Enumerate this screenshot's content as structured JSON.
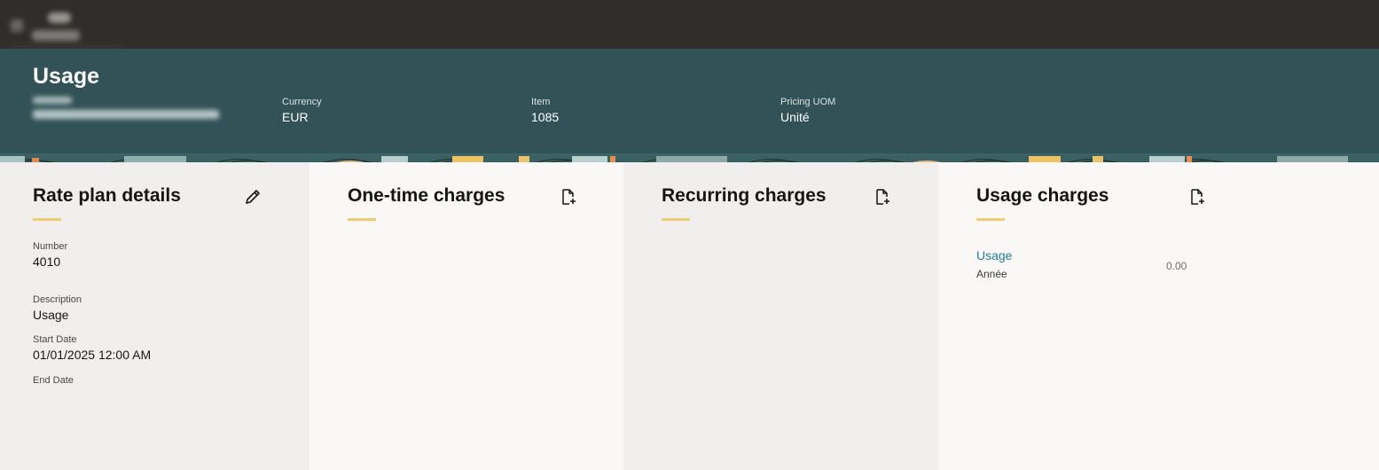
{
  "topbar": {},
  "header": {
    "title": "Usage",
    "meta": [
      {
        "label": "Currency",
        "value": "EUR"
      },
      {
        "label": "Item",
        "value": "1085"
      },
      {
        "label": "Pricing UOM",
        "value": "Unité"
      }
    ]
  },
  "panels": {
    "rate_plan": {
      "title": "Rate plan details",
      "icon": "pencil-icon",
      "fields": [
        {
          "label": "Number",
          "value": "4010"
        },
        {
          "label": "Description",
          "value": "Usage"
        },
        {
          "label": "Start Date",
          "value": "01/01/2025 12:00 AM"
        },
        {
          "label": "End Date",
          "value": ""
        }
      ]
    },
    "one_time": {
      "title": "One-time charges",
      "icon": "add-document-icon"
    },
    "recurring": {
      "title": "Recurring charges",
      "icon": "add-document-icon"
    },
    "usage": {
      "title": "Usage charges",
      "icon": "add-document-icon",
      "items": [
        {
          "name": "Usage",
          "period": "Année",
          "amount": "0.00"
        }
      ]
    }
  },
  "colors": {
    "topbar": "#312d2a",
    "header": "#325257",
    "accent": "#f0cc71",
    "link": "#227e9e",
    "panel_light": "#f9f8f6",
    "panel_gray": "#f1efed"
  }
}
